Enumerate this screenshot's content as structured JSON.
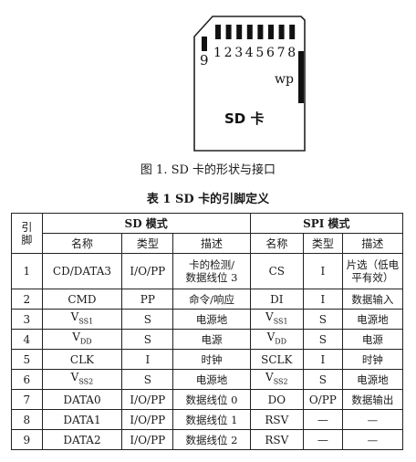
{
  "figure": {
    "pin_top_labels": [
      "1",
      "2",
      "3",
      "4",
      "5",
      "6",
      "7",
      "8"
    ],
    "pin_9_label": "9",
    "wp_label": "wp",
    "card_label": "SD 卡"
  },
  "figure_caption": "图 1. SD 卡的形状与接口",
  "table_caption": "表 1 SD 卡的引脚定义",
  "table": {
    "pin_header_line1": "引",
    "pin_header_line2": "脚",
    "sd_group_header": "SD 模式",
    "spi_group_header": "SPI 模式",
    "sub_headers": [
      "名称",
      "类型",
      "描述",
      "名称",
      "类型",
      "描述"
    ],
    "rows": [
      {
        "pin": "1",
        "sd_name": "CD/DATA3",
        "sd_type": "I/O/PP",
        "sd_desc": [
          "卡的检测/",
          "数据线位 3"
        ],
        "spi_name": "CS",
        "spi_type": "I",
        "spi_desc": [
          "片选（低电",
          "平有效）"
        ]
      },
      {
        "pin": "2",
        "sd_name": "CMD",
        "sd_type": "PP",
        "sd_desc": [
          "命令/响应"
        ],
        "spi_name": "DI",
        "spi_type": "I",
        "spi_desc": [
          "数据输入"
        ]
      },
      {
        "pin": "3",
        "sd_name": "V",
        "sd_name_sub": "SS1",
        "sd_type": "S",
        "sd_desc": [
          "电源地"
        ],
        "spi_name": "V",
        "spi_name_sub": "SS1",
        "spi_type": "S",
        "spi_desc": [
          "电源地"
        ]
      },
      {
        "pin": "4",
        "sd_name": "V",
        "sd_name_sub": "DD",
        "sd_type": "S",
        "sd_desc": [
          "电源"
        ],
        "spi_name": "V",
        "spi_name_sub": "DD",
        "spi_type": "S",
        "spi_desc": [
          "电源"
        ]
      },
      {
        "pin": "5",
        "sd_name": "CLK",
        "sd_type": "I",
        "sd_desc": [
          "时钟"
        ],
        "spi_name": "SCLK",
        "spi_type": "I",
        "spi_desc": [
          "时钟"
        ]
      },
      {
        "pin": "6",
        "sd_name": "V",
        "sd_name_sub": "SS2",
        "sd_type": "S",
        "sd_desc": [
          "电源地"
        ],
        "spi_name": "V",
        "spi_name_sub": "SS2",
        "spi_type": "S",
        "spi_desc": [
          "电源地"
        ]
      },
      {
        "pin": "7",
        "sd_name": "DATA0",
        "sd_type": "I/O/PP",
        "sd_desc": [
          "数据线位 0"
        ],
        "spi_name": "DO",
        "spi_type": "O/PP",
        "spi_desc": [
          "数据输出"
        ]
      },
      {
        "pin": "8",
        "sd_name": "DATA1",
        "sd_type": "I/O/PP",
        "sd_desc": [
          "数据线位 1"
        ],
        "spi_name": "RSV",
        "spi_type": "—",
        "spi_desc": [
          "—"
        ]
      },
      {
        "pin": "9",
        "sd_name": "DATA2",
        "sd_type": "I/O/PP",
        "sd_desc": [
          "数据线位 2"
        ],
        "spi_name": "RSV",
        "spi_type": "—",
        "spi_desc": [
          "—"
        ]
      }
    ]
  }
}
